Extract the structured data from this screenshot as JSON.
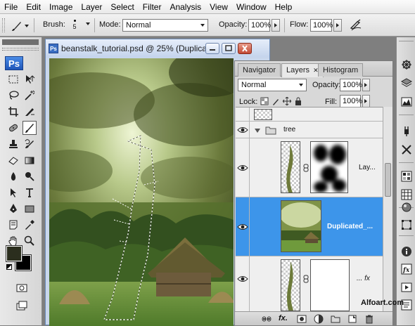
{
  "menu": [
    "File",
    "Edit",
    "Image",
    "Layer",
    "Select",
    "Filter",
    "Analysis",
    "View",
    "Window",
    "Help"
  ],
  "options": {
    "brush_label": "Brush:",
    "brush_size": "5",
    "mode_label": "Mode:",
    "mode_value": "Normal",
    "opacity_label": "Opacity:",
    "opacity_value": "100%",
    "flow_label": "Flow:",
    "flow_value": "100%"
  },
  "toolbox": {
    "logo": "Ps"
  },
  "document": {
    "title": "beanstalk_tutorial.psd @ 25% (Duplicat..."
  },
  "panel": {
    "tabs": [
      "Navigator",
      "Layers",
      "Histogram"
    ],
    "blend_mode": "Normal",
    "opacity_label": "Opacity:",
    "opacity_value": "100%",
    "lock_label": "Lock:",
    "fill_label": "Fill:",
    "fill_value": "100%",
    "layers": [
      {
        "name": "",
        "type": "partial"
      },
      {
        "name": "tree",
        "type": "group"
      },
      {
        "name": "Lay...",
        "type": "masked"
      },
      {
        "name": "Duplicated_...",
        "type": "image",
        "selected": true
      },
      {
        "name": "... fx",
        "type": "masked-fx"
      }
    ]
  },
  "watermark": "Alfoart.com",
  "colors": {
    "foreground": "#2b2e1e",
    "background": "#000000",
    "selection": "#3d95ea"
  }
}
